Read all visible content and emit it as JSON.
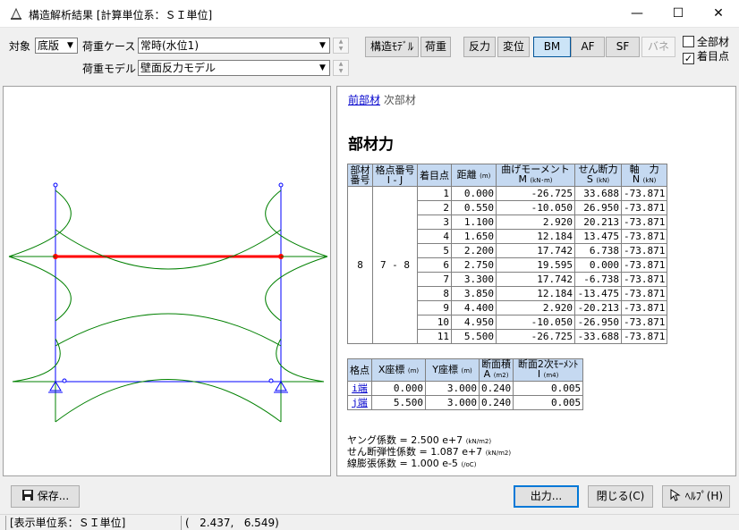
{
  "window": {
    "title": "構造解析結果 [計算単位系：ＳＩ単位]",
    "controls": {
      "minimize": "—",
      "maximize": "☐",
      "close": "✕"
    }
  },
  "toolbar": {
    "target_label": "対象",
    "target_value": "底版",
    "load_case_label": "荷重ケース",
    "load_case_value": "常時(水位1)",
    "load_model_label": "荷重モデル",
    "load_model_value": "壁面反力モデル",
    "buttons": {
      "structure_model": "構造ﾓﾃﾞﾙ",
      "load": "荷重",
      "reaction": "反力",
      "displacement": "変位",
      "bm": "BM",
      "af": "AF",
      "sf": "SF",
      "spring": "バネ"
    },
    "all_members_label": "全部材",
    "all_members_checked": false,
    "focus_points_label": "着目点",
    "focus_points_checked": true
  },
  "detail": {
    "links": {
      "prev": "前部材",
      "next": "次部材"
    },
    "heading": "部材力",
    "member_table": {
      "headers": {
        "member_no": [
          "部材",
          "番号"
        ],
        "node_no": [
          "格点番号",
          "I - J"
        ],
        "focus_point": "着目点",
        "distance": "距離",
        "distance_unit": "(m)",
        "moment": "曲げモーメント",
        "moment_symbol": "M",
        "moment_unit": "(kN･m)",
        "shear": "せん断力",
        "shear_symbol": "S",
        "shear_unit": "(kN)",
        "axial": "軸　力",
        "axial_symbol": "N",
        "axial_unit": "(kN)"
      },
      "member_no": "8",
      "node_ij": "7 - 8",
      "rows": [
        [
          "1",
          "0.000",
          "-26.725",
          "33.688",
          "-73.871"
        ],
        [
          "2",
          "0.550",
          "-10.050",
          "26.950",
          "-73.871"
        ],
        [
          "3",
          "1.100",
          "2.920",
          "20.213",
          "-73.871"
        ],
        [
          "4",
          "1.650",
          "12.184",
          "13.475",
          "-73.871"
        ],
        [
          "5",
          "2.200",
          "17.742",
          "6.738",
          "-73.871"
        ],
        [
          "6",
          "2.750",
          "19.595",
          "0.000",
          "-73.871"
        ],
        [
          "7",
          "3.300",
          "17.742",
          "-6.738",
          "-73.871"
        ],
        [
          "8",
          "3.850",
          "12.184",
          "-13.475",
          "-73.871"
        ],
        [
          "9",
          "4.400",
          "2.920",
          "-20.213",
          "-73.871"
        ],
        [
          "10",
          "4.950",
          "-10.050",
          "-26.950",
          "-73.871"
        ],
        [
          "11",
          "5.500",
          "-26.725",
          "-33.688",
          "-73.871"
        ]
      ]
    },
    "node_table": {
      "headers": {
        "node": "格点",
        "x": "X座標",
        "x_unit": "(m)",
        "y": "Y座標",
        "y_unit": "(m)",
        "area": "断面積",
        "area_symbol": "A",
        "area_unit": "(m2)",
        "inertia": "断面2次ﾓｰﾒﾝﾄ",
        "inertia_symbol": "I",
        "inertia_unit": "(m4)"
      },
      "rows": [
        [
          "i端",
          "0.000",
          "3.000",
          "0.240",
          "0.005"
        ],
        [
          "j端",
          "5.500",
          "3.000",
          "0.240",
          "0.005"
        ]
      ]
    },
    "constants": [
      {
        "label": "ヤング係数 = 2.500 e+7",
        "unit": "(kN/m2)"
      },
      {
        "label": "せん断弾性係数 = 1.087 e+7",
        "unit": "(kN/m2)"
      },
      {
        "label": "線膨張係数 = 1.000 e-5",
        "unit": "(/oC)"
      }
    ]
  },
  "bottom": {
    "save": "保存...",
    "output": "出力...",
    "close": "閉じる(C)",
    "help": "ﾍﾙﾌﾟ(H)"
  },
  "status": {
    "unit_system": "[表示単位系：ＳＩ単位]",
    "coords": "(   2.437,   6.549)"
  }
}
